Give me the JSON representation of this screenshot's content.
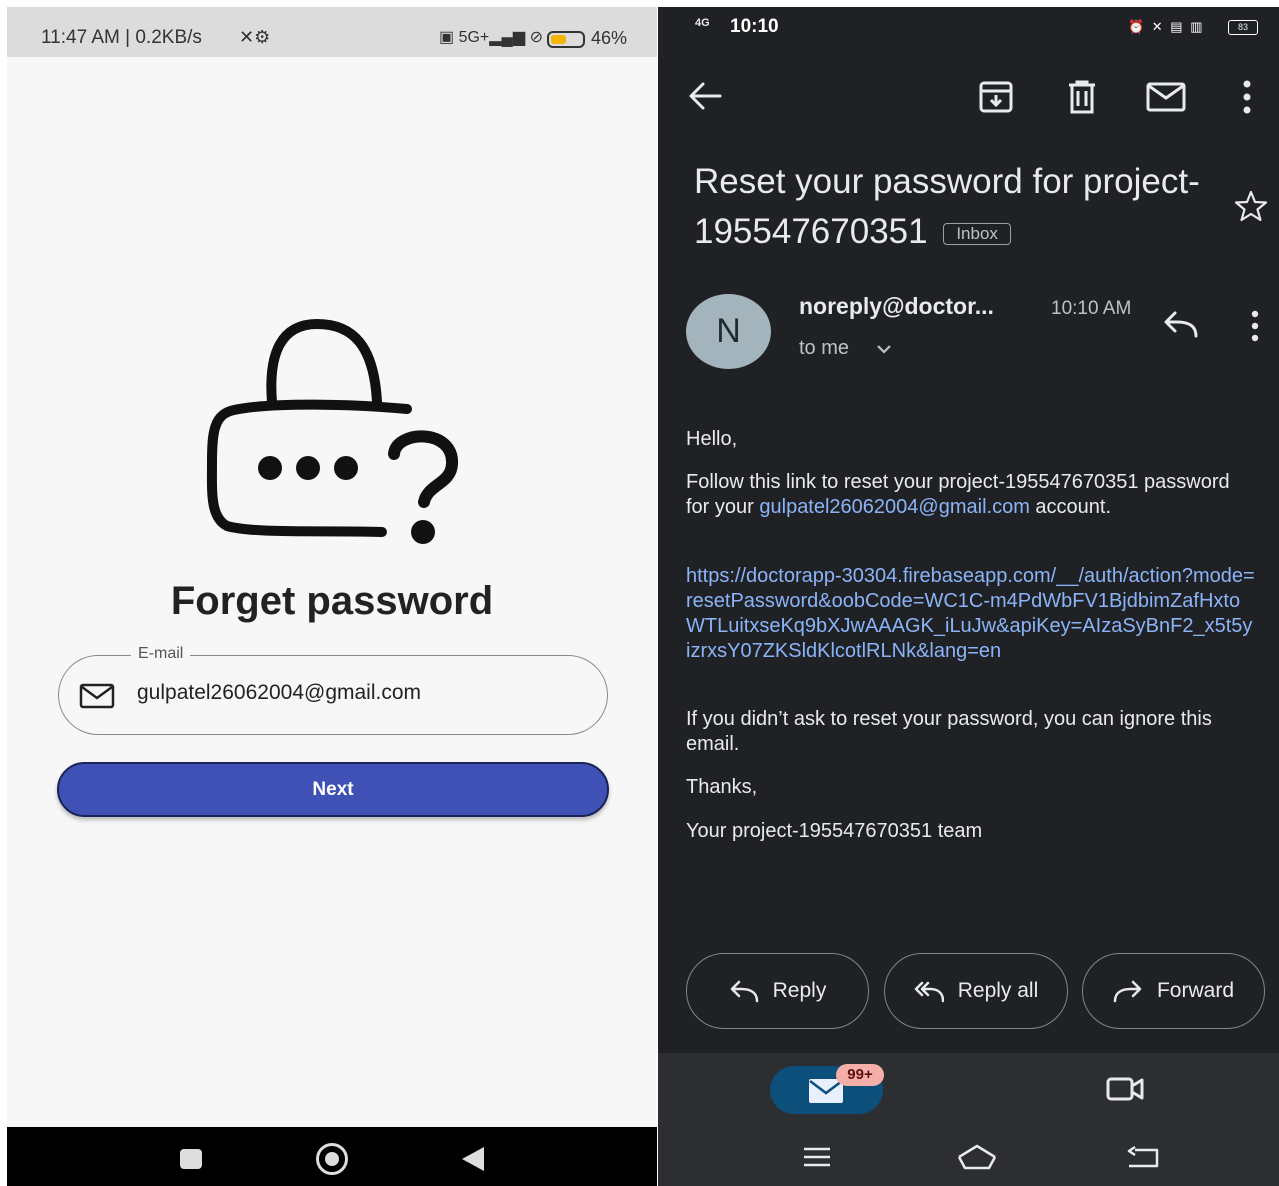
{
  "left_screen": {
    "status_bar": {
      "time": "11:47 AM | 0.2KB/s",
      "battery": "46%",
      "network": "5G+"
    },
    "title": "Forget password",
    "email_field": {
      "label": "E-mail",
      "value": "gulpatel26062004@gmail.com",
      "icon": "mail-outline-icon"
    },
    "next_button": "Next",
    "colors": {
      "button": "#3f51b5",
      "background": "#f7f7f7"
    }
  },
  "right_screen": {
    "status_bar": {
      "time": "10:10",
      "signal": "4G",
      "battery": "83"
    },
    "toolbar_icons": [
      "back-arrow-icon",
      "archive-icon",
      "trash-icon",
      "mail-icon",
      "more-vertical-icon"
    ],
    "subject": "Reset your password for project-195547670351",
    "label": "Inbox",
    "sender": {
      "avatar_letter": "N",
      "name": "noreply@doctor...",
      "time": "10:10 AM",
      "recipient": "to me"
    },
    "body": {
      "greeting": "Hello,",
      "line1_prefix": "Follow this link to reset your project-195547670351 password for your",
      "line1_email": "gulpatel26062004@gmail.com",
      "line1_suffix": "account.",
      "reset_link": "https://doctorapp-30304.firebaseapp.com/__/auth/action?mode=resetPassword&oobCode=WC1C-m4PdWbFV1BjdbimZafHxtoWTLuitxseKq9bXJwAAAGK_iLuJw&apiKey=AIzaSyBnF2_x5t5yizrxsY07ZKSldKlcotlRLNk&lang=en",
      "ignore_note": "If you didn’t ask to reset your password, you can ignore this email.",
      "thanks": "Thanks,",
      "signature": "Your project-195547670351 team"
    },
    "actions": {
      "reply": "Reply",
      "reply_all": "Reply all",
      "forward": "Forward"
    },
    "bottom_nav": {
      "mail_badge": "99+"
    },
    "colors": {
      "background": "#202124",
      "link": "#8ab4f8",
      "avatar": "#a3b4bd"
    }
  }
}
